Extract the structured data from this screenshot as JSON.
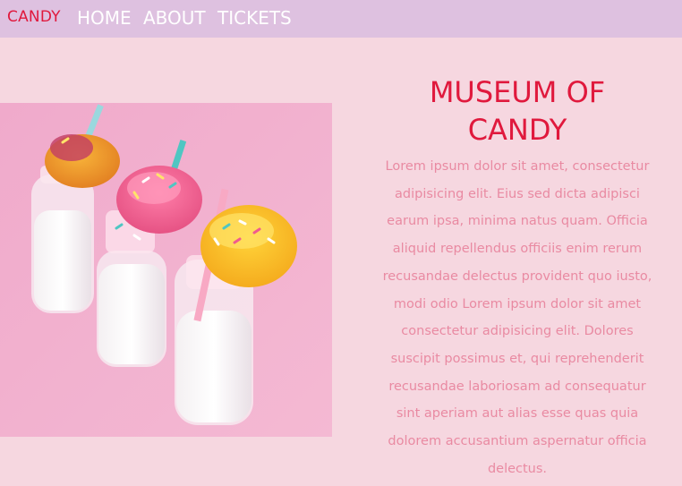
{
  "nav": {
    "brand": "CANDY",
    "links": [
      "HOME",
      "ABOUT",
      "TICKETS"
    ]
  },
  "hero": {
    "title": "MUSEUM OF CANDY",
    "description": "Lorem ipsum dolor sit amet, consectetur adipisicing elit. Eius sed dicta adipisci earum ipsa, minima natus quam. Officia aliquid repellendus officiis enim rerum recusandae delectus provident quo iusto, modi odio Lorem ipsum dolor sit amet consectetur adipisicing elit. Dolores suscipit possimus et, qui reprehenderit recusandae laboriosam ad consequatur sint aperiam aut alias esse quas quia dolorem accusantium aspernatur officia delectus."
  },
  "colors": {
    "nav_background": "#dec1e0",
    "page_background": "#f6d7e0",
    "accent": "#e0193d",
    "body_text": "#e98aa2"
  }
}
